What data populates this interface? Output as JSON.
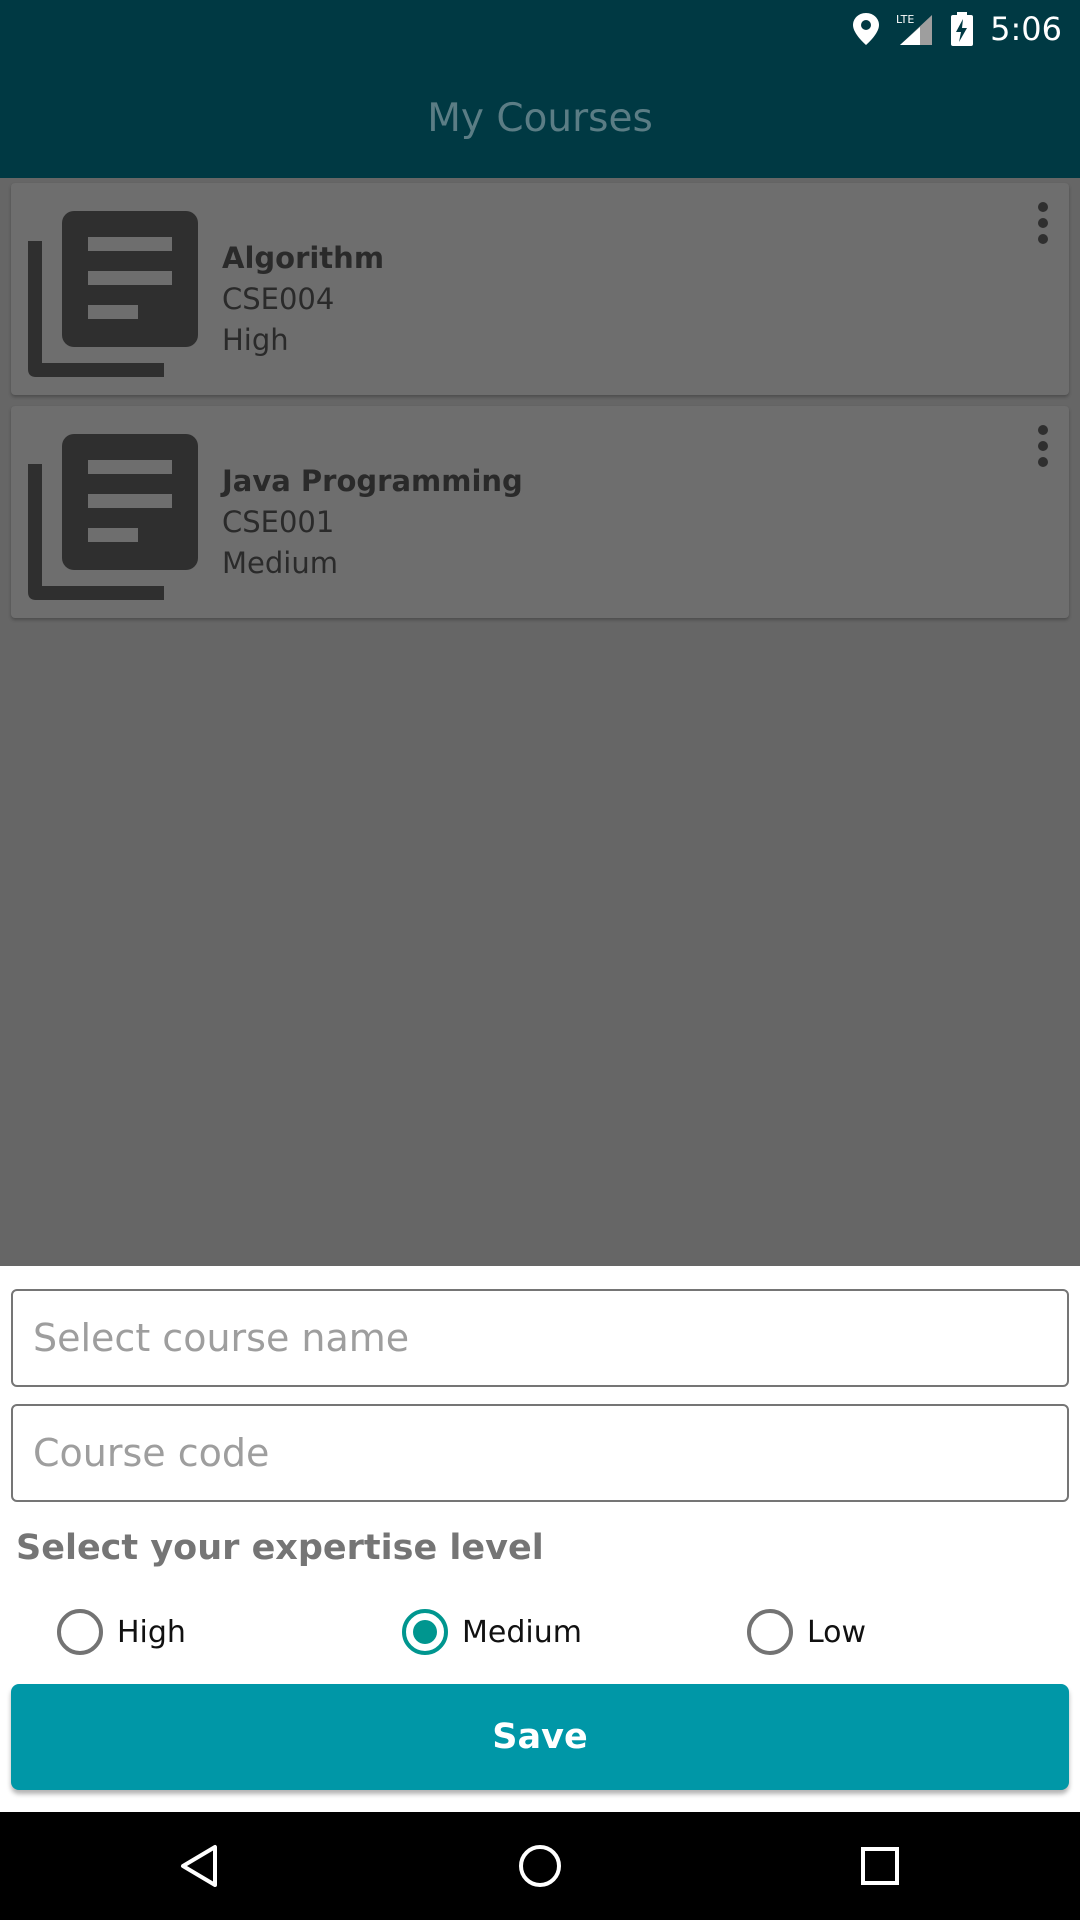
{
  "status_bar": {
    "time": "5:06",
    "icons": [
      "location-icon",
      "lte-signal-icon",
      "battery-charging-icon"
    ],
    "network_label": "LTE"
  },
  "app_bar": {
    "title": "My Courses"
  },
  "courses": [
    {
      "name": "Algorithm",
      "code": "CSE004",
      "level": "High",
      "icon": "library-books-icon"
    },
    {
      "name": "Java Programming",
      "code": "CSE001",
      "level": "Medium",
      "icon": "library-books-icon"
    }
  ],
  "form": {
    "course_name_placeholder": "Select course name",
    "course_name_value": "",
    "course_code_placeholder": "Course code",
    "course_code_value": "",
    "expertise_label": "Select your expertise level",
    "levels": [
      {
        "label": "High",
        "checked": false
      },
      {
        "label": "Medium",
        "checked": true
      },
      {
        "label": "Low",
        "checked": false
      }
    ],
    "save_label": "Save"
  },
  "nav_bar": {
    "icons": [
      "back-icon",
      "home-icon",
      "recents-icon"
    ]
  },
  "colors": {
    "app_bar": "#003943",
    "accent": "#0097a7",
    "radio_checked": "#00968f",
    "scrim": "#666666"
  }
}
